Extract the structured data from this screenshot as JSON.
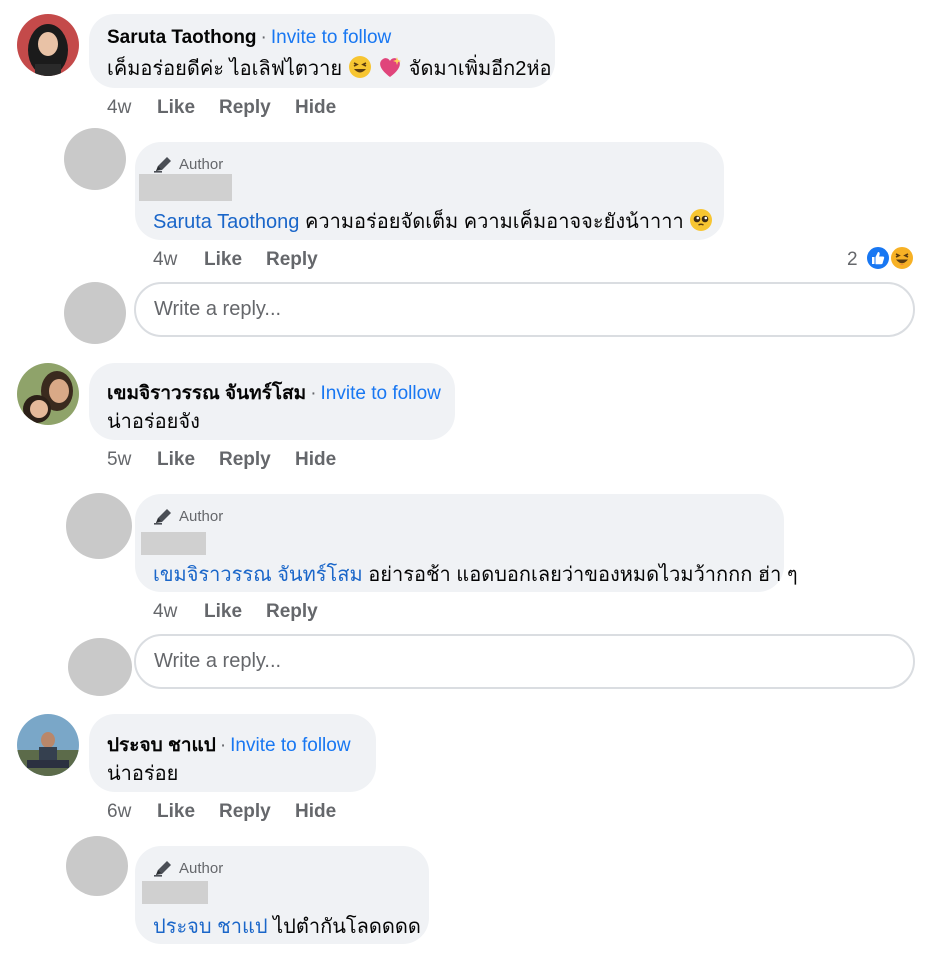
{
  "comments": [
    {
      "name": "Saruta Taothong",
      "separator": "·",
      "invite": "Invite to follow",
      "text": "เค็มอร่อยดีค่ะ ไอเลิฟไตวาย",
      "text_after_emoji": "จัดมาเพิ่มอีก2ห่อ",
      "time": "4w",
      "like": "Like",
      "reply": "Reply",
      "hide": "Hide",
      "author_reply": {
        "badge": "Author",
        "mention": "Saruta Taothong",
        "text": "ความอร่อยจัดเต็ม ความเค็มอาจจะยังน้าาาา",
        "time": "4w",
        "like": "Like",
        "reply": "Reply",
        "reaction_count": "2"
      },
      "reply_placeholder": "Write a reply..."
    },
    {
      "name": "เขมจิราวรรณ จันทร์โสม",
      "separator": "·",
      "invite": "Invite to follow",
      "text": "น่าอร่อยจัง",
      "time": "5w",
      "like": "Like",
      "reply": "Reply",
      "hide": "Hide",
      "author_reply": {
        "badge": "Author",
        "mention": "เขมจิราวรรณ จันทร์โสม",
        "text": "อย่ารอช้า แอดบอกเลยว่าของหมดไวมว้ากกก ฮ่า ๆ",
        "time": "4w",
        "like": "Like",
        "reply": "Reply"
      },
      "reply_placeholder": "Write a reply..."
    },
    {
      "name": "ประจบ ชาแป",
      "separator": "·",
      "invite": "Invite to follow",
      "text": "น่าอร่อย",
      "time": "6w",
      "like": "Like",
      "reply": "Reply",
      "hide": "Hide",
      "author_reply": {
        "badge": "Author",
        "mention": "ประจบ ชาแป",
        "text": "ไปตำกันโลดดดด"
      }
    }
  ],
  "colors": {
    "link": "#1877f2",
    "mention": "#1a66c9",
    "bubble": "#f0f2f5",
    "secondary_text": "#65676b",
    "like_reaction": "#1877f2",
    "haha_reaction": "#f7b125"
  },
  "icons": {
    "author_badge": "pen-icon",
    "reaction_like": "thumbs-up-icon",
    "reaction_haha": "laughing-face-icon"
  }
}
